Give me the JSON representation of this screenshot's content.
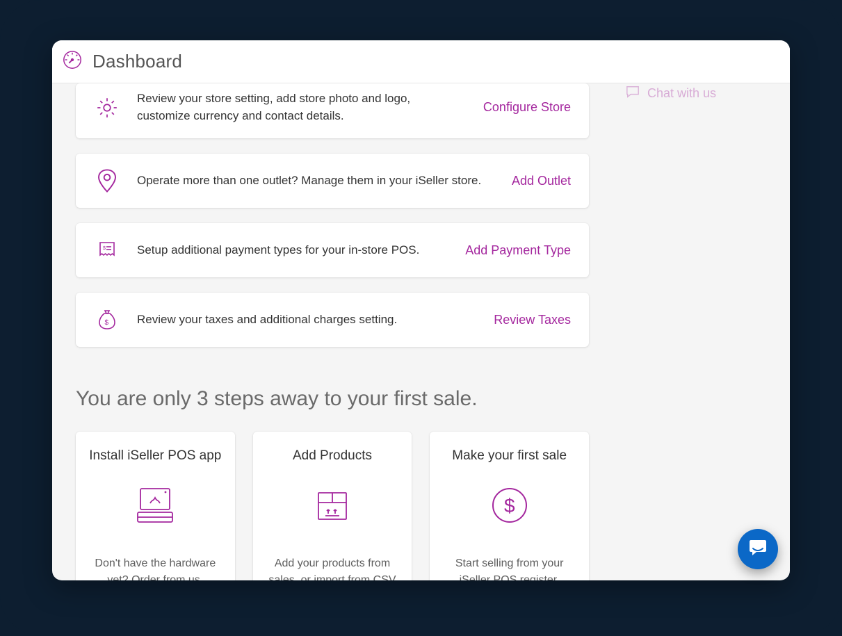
{
  "header": {
    "title": "Dashboard"
  },
  "sideChat": {
    "label": "Chat with us"
  },
  "setupCards": [
    {
      "id": "configure-store",
      "icon": "gear-icon",
      "desc": "Review your store setting, add store photo and logo, customize currency and contact details.",
      "action": "Configure Store"
    },
    {
      "id": "add-outlet",
      "icon": "pin-icon",
      "desc": "Operate more than one outlet? Manage them in your iSeller store.",
      "action": "Add Outlet"
    },
    {
      "id": "add-payment-type",
      "icon": "receipt-icon",
      "desc": "Setup additional payment types for your in-store POS.",
      "action": "Add Payment Type"
    },
    {
      "id": "review-taxes",
      "icon": "money-bag-icon",
      "desc": "Review your taxes and additional charges setting.",
      "action": "Review Taxes"
    }
  ],
  "stepsSection": {
    "title": "You are only 3 steps away to your first sale.",
    "steps": [
      {
        "id": "install-app",
        "title": "Install iSeller POS app",
        "icon": "pos-device-icon",
        "desc": "Don't have the hardware yet? Order from us."
      },
      {
        "id": "add-products",
        "title": "Add Products",
        "icon": "package-box-icon",
        "desc": "Add your products from sales, or import from CSV in bulk."
      },
      {
        "id": "first-sale",
        "title": "Make your first sale",
        "icon": "dollar-circle-icon",
        "desc": "Start selling from your iSeller POS register."
      }
    ]
  },
  "colors": {
    "accent": "#a4279e",
    "fab": "#0b68c7"
  }
}
